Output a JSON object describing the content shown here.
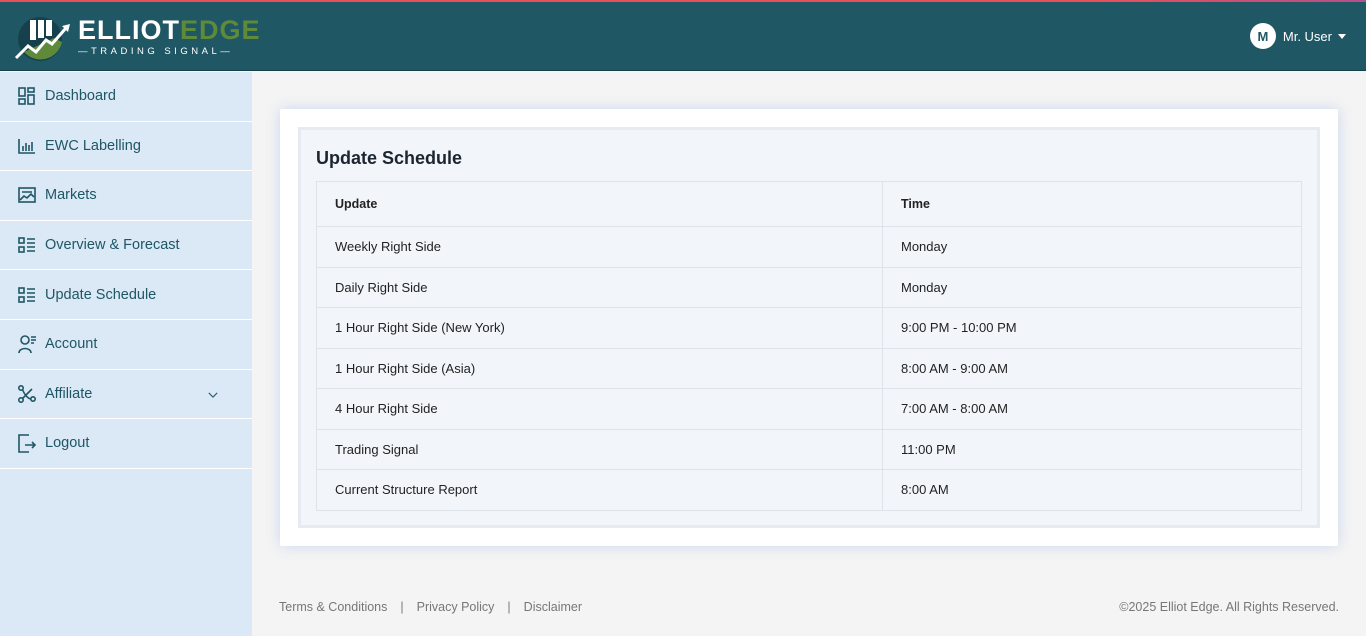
{
  "header": {
    "logo_part1": "ELLIOT",
    "logo_part2": "EDGE",
    "logo_sub": "—TRADING SIGNAL—",
    "user_initial": "M",
    "user_name": "Mr. User"
  },
  "sidebar": {
    "items": [
      {
        "label": "Dashboard",
        "icon": "dashboard-icon"
      },
      {
        "label": "EWC Labelling",
        "icon": "chart-icon"
      },
      {
        "label": "Markets",
        "icon": "markets-icon"
      },
      {
        "label": "Overview & Forecast",
        "icon": "list-icon"
      },
      {
        "label": "Update Schedule",
        "icon": "list-icon"
      },
      {
        "label": "Account",
        "icon": "account-icon"
      },
      {
        "label": "Affiliate",
        "icon": "affiliate-icon"
      },
      {
        "label": "Logout",
        "icon": "logout-icon"
      }
    ]
  },
  "main": {
    "title": "Update Schedule",
    "columns": [
      "Update",
      "Time"
    ],
    "rows": [
      [
        "Weekly Right Side",
        "Monday"
      ],
      [
        "Daily Right Side",
        "Monday"
      ],
      [
        "1 Hour Right Side (New York)",
        "9:00 PM - 10:00 PM"
      ],
      [
        "1 Hour Right Side (Asia)",
        "8:00 AM - 9:00 AM"
      ],
      [
        "4 Hour Right Side",
        "7:00 AM - 8:00 AM"
      ],
      [
        "Trading Signal",
        "11:00 PM"
      ],
      [
        "Current Structure Report",
        "8:00 AM"
      ]
    ]
  },
  "footer": {
    "links": [
      "Terms & Conditions",
      "Privacy Policy",
      "Disclaimer"
    ],
    "separator": "|",
    "copyright": "©2025 Elliot Edge. All Rights Reserved."
  }
}
